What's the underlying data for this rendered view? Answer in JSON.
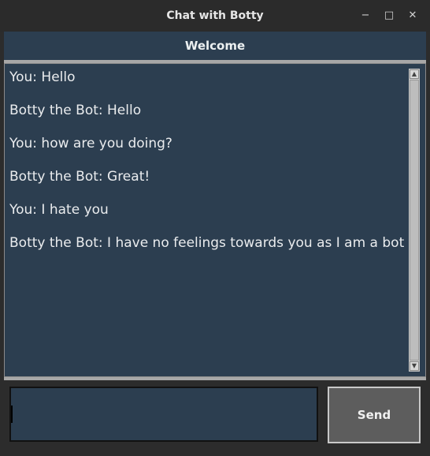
{
  "window": {
    "title": "Chat with Botty",
    "controls": {
      "minimize": "−",
      "maximize": "□",
      "close": "✕"
    }
  },
  "header": {
    "title": "Welcome"
  },
  "messages": [
    {
      "text": "You: Hello"
    },
    {
      "text": "Botty the Bot: Hello"
    },
    {
      "text": "You: how are you doing?"
    },
    {
      "text": "Botty the Bot: Great!"
    },
    {
      "text": "You: I hate you"
    },
    {
      "text": "Botty the Bot: I have no feelings towards you as I am a bot"
    }
  ],
  "scrollbar": {
    "up_arrow": "▲",
    "down_arrow": "▼"
  },
  "input": {
    "value": "",
    "placeholder": ""
  },
  "send_button": {
    "label": "Send"
  },
  "colors": {
    "chat_background": "#2c3e50",
    "text": "#eaecee",
    "button_background": "#5d5d5d"
  }
}
